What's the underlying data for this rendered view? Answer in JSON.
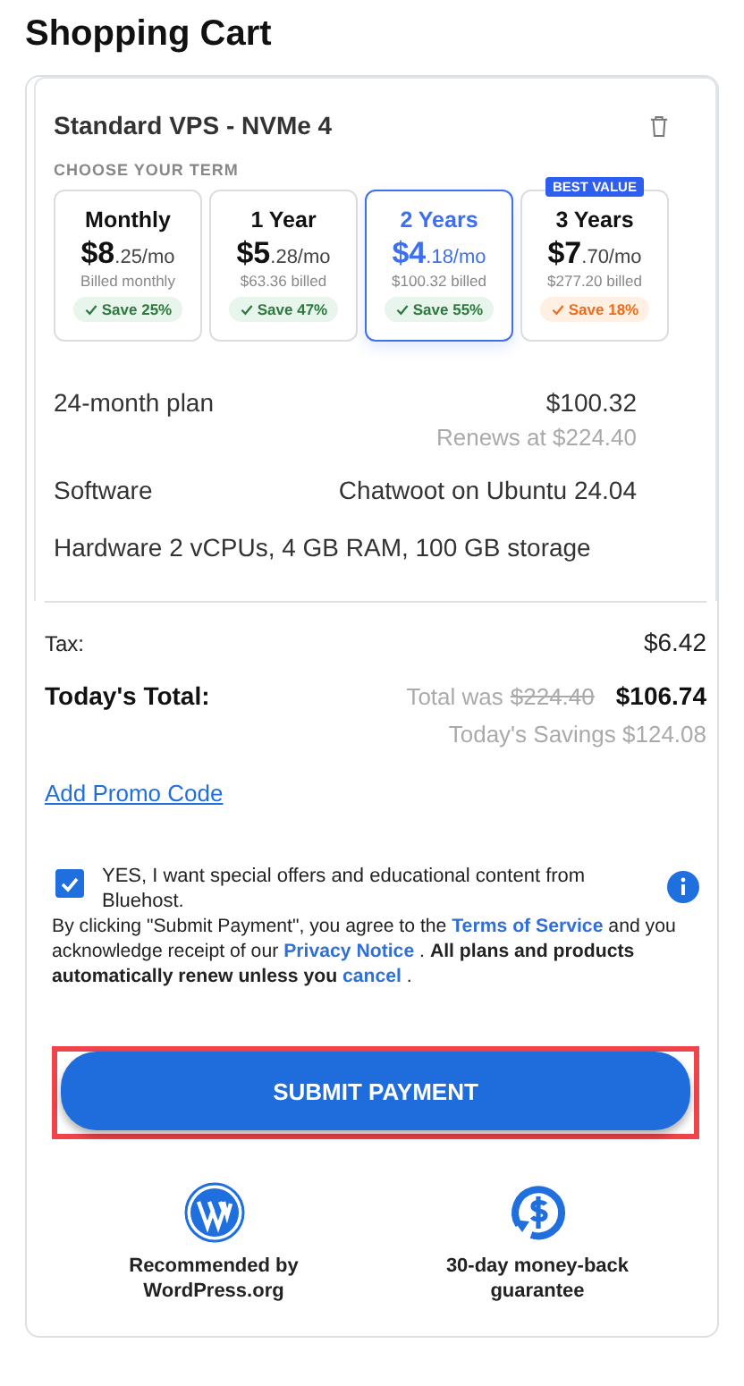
{
  "title": "Shopping Cart",
  "product": {
    "name": "Standard VPS - NVMe 4",
    "term_heading": "CHOOSE YOUR TERM",
    "terms": [
      {
        "label": "Monthly",
        "price_main": "$8",
        "price_rest": ".25/mo",
        "billed": "Billed monthly",
        "savings": "Save 25%",
        "kind": "good",
        "selected": false
      },
      {
        "label": "1 Year",
        "price_main": "$5",
        "price_rest": ".28/mo",
        "billed": "$63.36 billed",
        "savings": "Save 47%",
        "kind": "good",
        "selected": false
      },
      {
        "label": "2 Years",
        "price_main": "$4",
        "price_rest": ".18/mo",
        "billed": "$100.32 billed",
        "savings": "Save 55%",
        "kind": "good",
        "selected": true
      },
      {
        "label": "3 Years",
        "badge": "BEST VALUE",
        "price_main": "$7",
        "price_rest": ".70/mo",
        "billed": "$277.20 billed",
        "savings": "Save 18%",
        "kind": "warn",
        "selected": false
      }
    ],
    "plan_label": "24-month plan",
    "plan_price": "$100.32",
    "renews": "Renews at $224.40",
    "software_label": "Software",
    "software_value": "Chatwoot on Ubuntu 24.04",
    "hardware": "Hardware 2 vCPUs, 4 GB RAM, 100 GB storage"
  },
  "summary": {
    "tax_label": "Tax:",
    "tax_value": "$6.42",
    "total_label": "Today's Total:",
    "was_label": "Total was",
    "was_value": "$224.40",
    "total_value": "$106.74",
    "savings": "Today's Savings $124.08"
  },
  "promo_link": "Add Promo Code",
  "offers": {
    "checked": true,
    "label": "YES, I want special offers and educational content from Bluehost."
  },
  "legal": [
    {
      "kind": "text",
      "text": "By clicking \"Submit Payment\", you agree to the "
    },
    {
      "kind": "link",
      "text": "Terms of Service"
    },
    {
      "kind": "text",
      "text": " and you acknowledge receipt of our "
    },
    {
      "kind": "link",
      "text": "Privacy Notice"
    },
    {
      "kind": "text",
      "text": " .  "
    },
    {
      "kind": "bold",
      "text": "All plans and products automatically renew unless you "
    },
    {
      "kind": "link",
      "text": "cancel"
    },
    {
      "kind": "text",
      "text": " ."
    }
  ],
  "submit": "SUBMIT PAYMENT",
  "trust": [
    {
      "kind": "wordpress",
      "text": "Recommended by WordPress.org"
    },
    {
      "kind": "refund",
      "text": "30-day money-back guarantee"
    }
  ]
}
